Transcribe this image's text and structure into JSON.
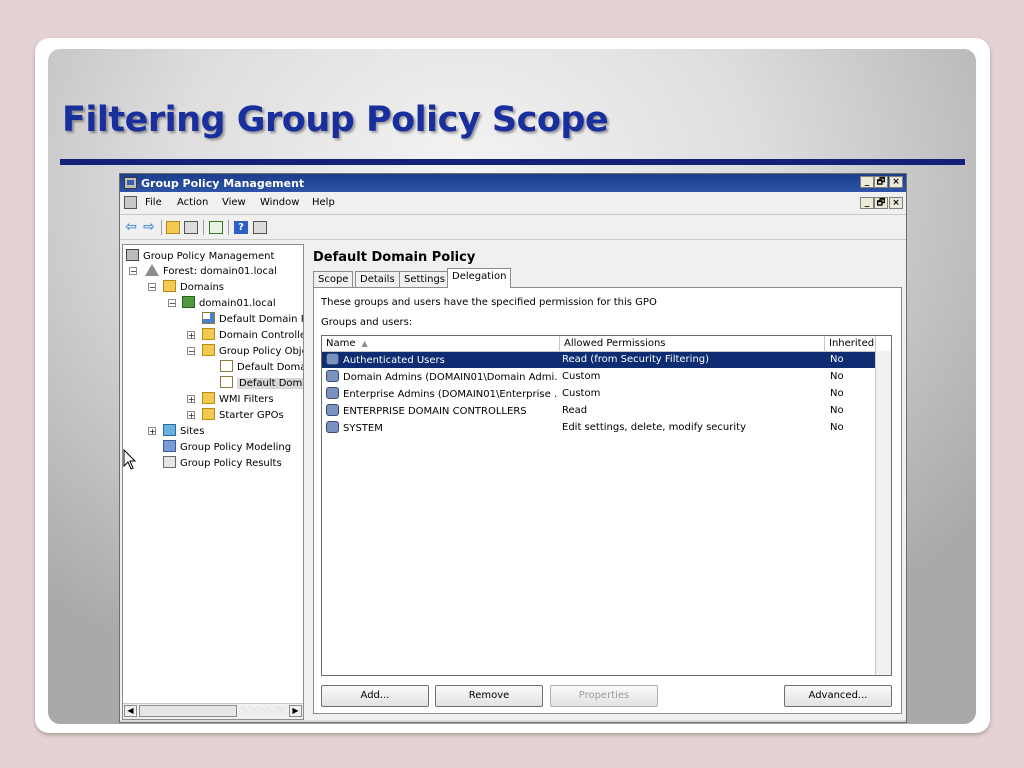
{
  "slide": {
    "title": "Filtering Group Policy Scope"
  },
  "window": {
    "title": "Group Policy Management",
    "controls": {
      "minimize": "_",
      "restore": "🗗",
      "close": "×"
    },
    "menu": [
      "File",
      "Action",
      "View",
      "Window",
      "Help"
    ]
  },
  "tree": {
    "root": "Group Policy Management",
    "forest": "Forest: domain01.local",
    "domains": "Domains",
    "domain": "domain01.local",
    "default_domain_policy_link": "Default Domain Pc",
    "domain_controllers": "Domain Controller",
    "gpo_folder": "Group Policy Obje",
    "gpo_1": "Default Doma",
    "gpo_2": "Default Doma",
    "wmi_filters": "WMI Filters",
    "starter_gpos": "Starter GPOs",
    "sites": "Sites",
    "modeling": "Group Policy Modeling",
    "results": "Group Policy Results",
    "expand": "+",
    "collapse": "−"
  },
  "details": {
    "title": "Default Domain Policy",
    "tabs": [
      "Scope",
      "Details",
      "Settings",
      "Delegation"
    ],
    "active_tab": "Delegation",
    "description": "These groups and users have the specified permission for this GPO",
    "groups_label": "Groups and users:",
    "columns": [
      "Name",
      "Allowed Permissions",
      "Inherited"
    ],
    "sort_indicator": "▲",
    "rows": [
      {
        "name": "Authenticated Users",
        "permissions": "Read (from Security Filtering)",
        "inherited": "No"
      },
      {
        "name": "Domain Admins (DOMAIN01\\Domain Admi...",
        "permissions": "Custom",
        "inherited": "No"
      },
      {
        "name": "Enterprise Admins (DOMAIN01\\Enterprise ...",
        "permissions": "Custom",
        "inherited": "No"
      },
      {
        "name": "ENTERPRISE DOMAIN CONTROLLERS",
        "permissions": "Read",
        "inherited": "No"
      },
      {
        "name": "SYSTEM",
        "permissions": "Edit settings, delete, modify security",
        "inherited": "No"
      }
    ],
    "selected_row": 0,
    "buttons": {
      "add": "Add...",
      "remove": "Remove",
      "properties": "Properties",
      "advanced": "Advanced..."
    }
  }
}
